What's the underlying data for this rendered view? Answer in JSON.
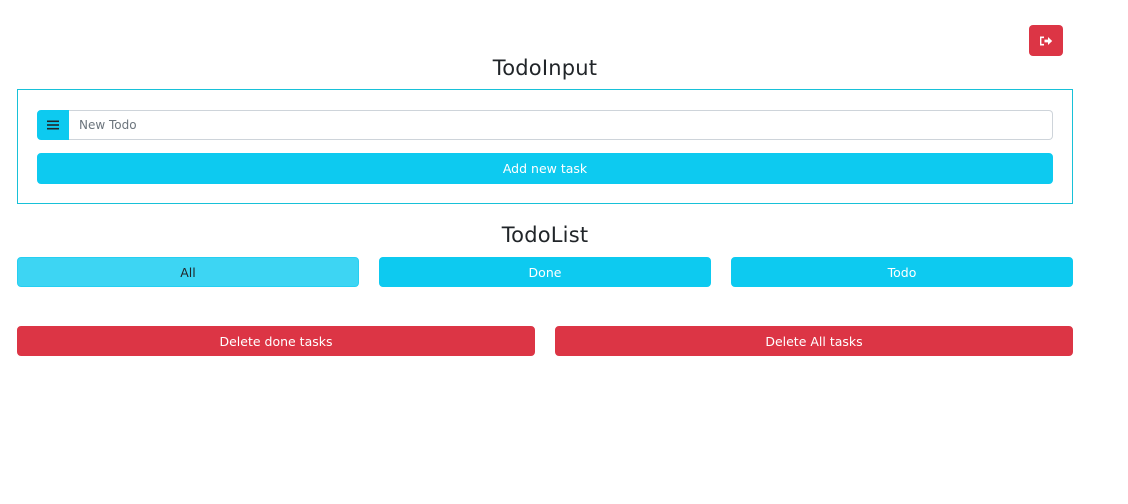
{
  "header": {
    "logout_icon": "sign-out-icon",
    "logout_color": "#dc3545"
  },
  "todo_input": {
    "title": "TodoInput",
    "prepend_icon": "list-icon",
    "placeholder": "New Todo",
    "value": "",
    "add_button_label": "Add new task"
  },
  "todo_list": {
    "title": "TodoList",
    "filters": [
      {
        "label": "All",
        "active": true
      },
      {
        "label": "Done",
        "active": false
      },
      {
        "label": "Todo",
        "active": false
      }
    ],
    "delete_done_label": "Delete done tasks",
    "delete_all_label": "Delete All tasks"
  },
  "colors": {
    "info": "#0dcaf0",
    "danger": "#dc3545",
    "border": "#17c1d8"
  }
}
